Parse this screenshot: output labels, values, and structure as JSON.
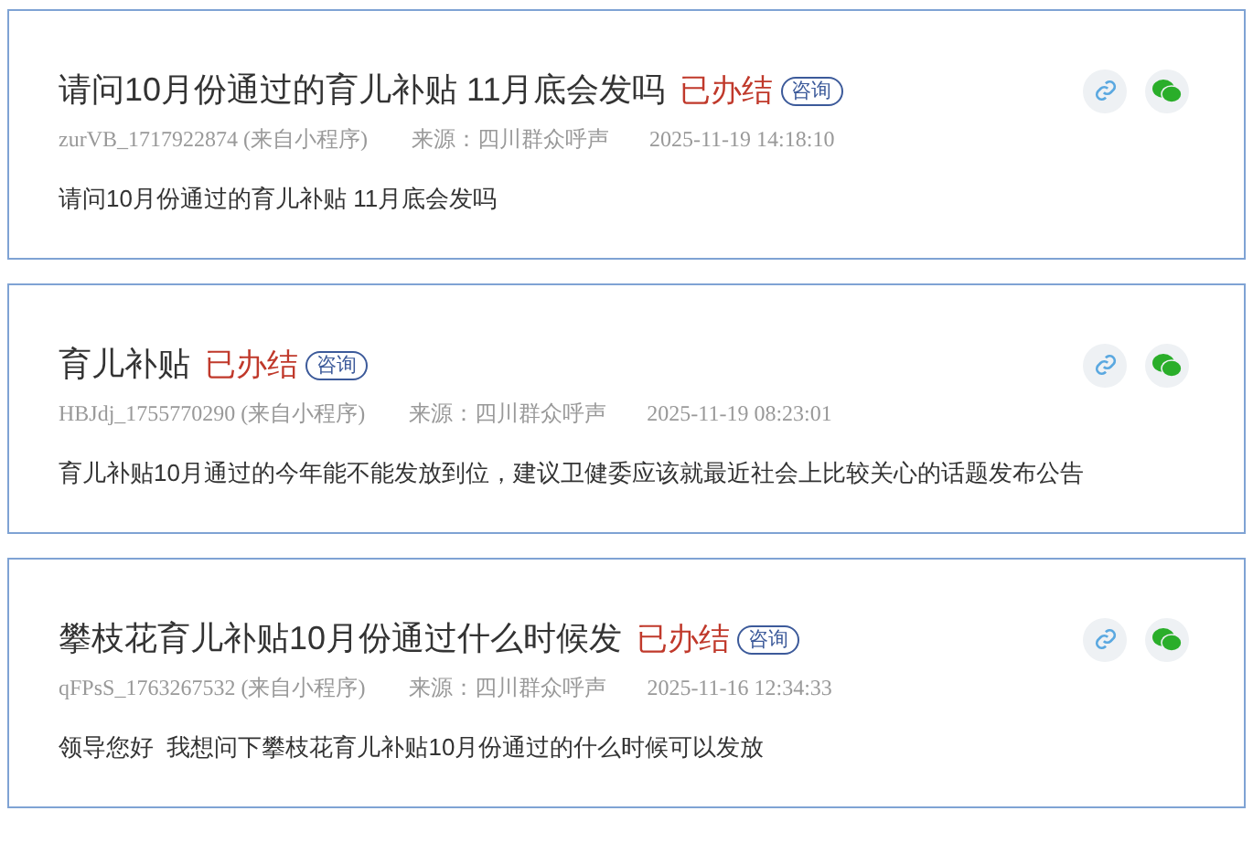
{
  "posts": [
    {
      "title": "请问10月份通过的育儿补贴 11月底会发吗",
      "status": "已办结",
      "tag": "咨询",
      "author": "zurVB_1717922874 (来自小程序)",
      "source": "来源：四川群众呼声",
      "time": "2025-11-19 14:18:10",
      "body": "请问10月份通过的育儿补贴 11月底会发吗"
    },
    {
      "title": "育儿补贴",
      "status": "已办结",
      "tag": "咨询",
      "author": "HBJdj_1755770290 (来自小程序)",
      "source": "来源：四川群众呼声",
      "time": "2025-11-19 08:23:01",
      "body": "育儿补贴10月通过的今年能不能发放到位，建议卫健委应该就最近社会上比较关心的话题发布公告"
    },
    {
      "title": "攀枝花育儿补贴10月份通过什么时候发",
      "status": "已办结",
      "tag": "咨询",
      "author": "qFPsS_1763267532 (来自小程序)",
      "source": "来源：四川群众呼声",
      "time": "2025-11-16 12:34:33",
      "body": "领导您好  我想问下攀枝花育儿补贴10月份通过的什么时候可以发放"
    }
  ]
}
